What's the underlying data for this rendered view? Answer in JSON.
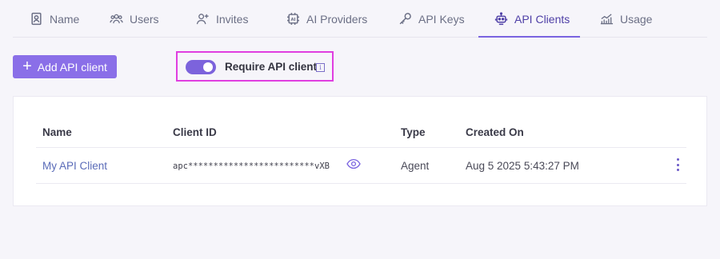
{
  "tabs": [
    {
      "label": "Name",
      "icon": "id-badge-icon"
    },
    {
      "label": "Users",
      "icon": "users-icon"
    },
    {
      "label": "Invites",
      "icon": "user-plus-icon"
    },
    {
      "label": "AI Providers",
      "icon": "ai-chip-icon"
    },
    {
      "label": "API Keys",
      "icon": "key-icon"
    },
    {
      "label": "API Clients",
      "icon": "robot-icon",
      "active": true
    },
    {
      "label": "Usage",
      "icon": "chart-icon"
    }
  ],
  "actions": {
    "add_label": "Add API client"
  },
  "toggle": {
    "label": "Require API client",
    "enabled": true,
    "info": "i"
  },
  "table": {
    "headers": [
      "Name",
      "Client ID",
      "Type",
      "Created On"
    ],
    "rows": [
      {
        "name": "My API Client",
        "client_id": "apc*************************vXB",
        "type": "Agent",
        "created_on": "Aug 5 2025 5:43:27 PM"
      }
    ]
  },
  "colors": {
    "accent": "#8a6fe8",
    "active_tab": "#4e3fa6",
    "highlight_border": "#e03ee0",
    "link": "#5a6bb8"
  }
}
